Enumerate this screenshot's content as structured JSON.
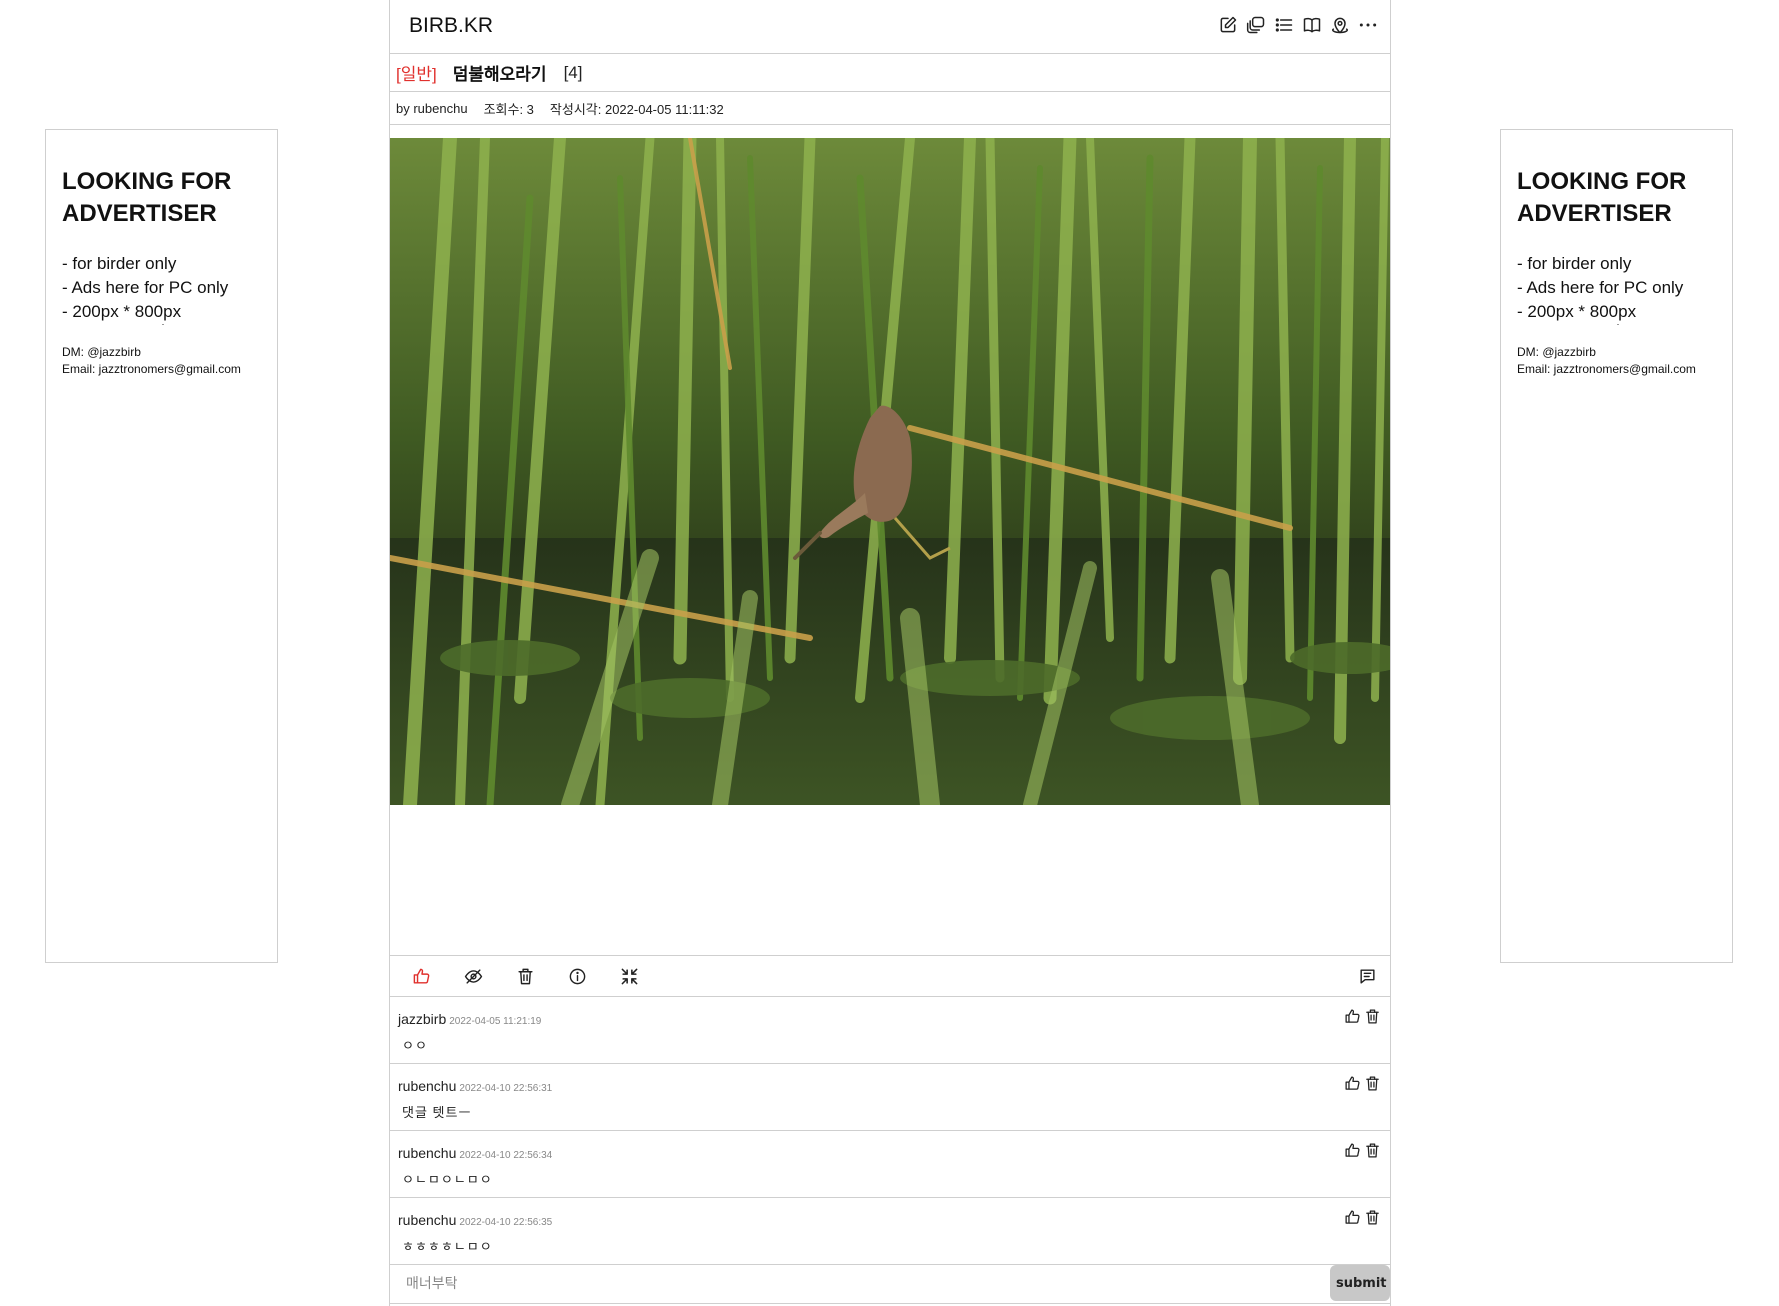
{
  "ads": {
    "title": "LOOKING FOR\nADVERTISER",
    "line1": "- for birder only",
    "line2": "- Ads here for PC only",
    "line3": "- 200px * 800px",
    "dm": "DM: @jazzbirb",
    "email": "Email: jazztronomers@gmail.com"
  },
  "header": {
    "logo": "BIRB.KR",
    "icons": [
      "compose-icon",
      "gallery-icon",
      "list-icon",
      "book-icon",
      "map-icon",
      "more-icon"
    ]
  },
  "post": {
    "category": "[일반]",
    "title": "덤불해오라기",
    "comment_count": "[4]",
    "author": "by rubenchu",
    "views": "조회수: 3",
    "created": "작성시각: 2022-04-05 11:11:32"
  },
  "actions": [
    "like-icon",
    "hide-icon",
    "trash-icon",
    "info-icon",
    "collapse-icon",
    "comment-icon"
  ],
  "comments": [
    {
      "author": "jazzbirb",
      "date": "2022-04-05 11:21:19",
      "text": "ㅇㅇ"
    },
    {
      "author": "rubenchu",
      "date": "2022-04-10 22:56:31",
      "text": "댓글 텟트ㅡ"
    },
    {
      "author": "rubenchu",
      "date": "2022-04-10 22:56:34",
      "text": "ㅇㄴㅁㅇㄴㅁㅇ"
    },
    {
      "author": "rubenchu",
      "date": "2022-04-10 22:56:35",
      "text": "ㅎㅎㅎㅎㄴㅁㅇ"
    }
  ],
  "reply": {
    "placeholder": "매너부탁",
    "submit_label": "submit"
  },
  "colors": {
    "category": "#e0302d",
    "like_active": "#e0302d",
    "border": "#cfcfcf",
    "submit_bg": "#c8c8c8"
  }
}
